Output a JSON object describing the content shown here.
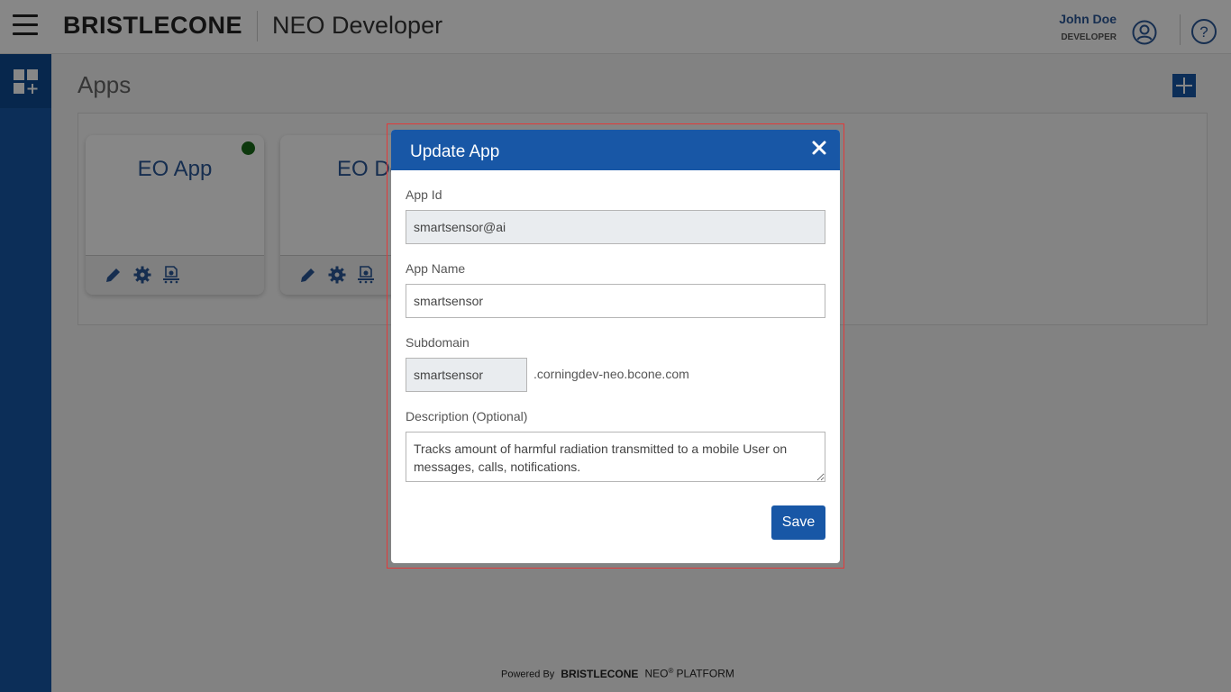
{
  "header": {
    "brand": "BRISTLECONE",
    "app_title": "NEO Developer",
    "user_name": "John Doe",
    "user_role": "DEVELOPER"
  },
  "main": {
    "title": "Apps",
    "apps": [
      {
        "name": "EO App",
        "status": "active"
      },
      {
        "name": "EO Do"
      }
    ]
  },
  "modal": {
    "title": "Update App",
    "app_id_label": "App Id",
    "app_id_value": "smartsensor@ai",
    "app_name_label": "App Name",
    "app_name_value": "smartsensor",
    "subdomain_label": "Subdomain",
    "subdomain_value": "smartsensor",
    "subdomain_suffix": ".corningdev-neo.bcone.com",
    "description_label": "Description (Optional)",
    "description_value": "Tracks amount of harmful radiation transmitted to a mobile User on messages, calls, notifications.",
    "save_label": "Save"
  },
  "footer": {
    "powered_by": "Powered By",
    "brand": "BRISTLECONE",
    "neo": "NEO",
    "reg": "®",
    "platform": "PLATFORM"
  },
  "colors": {
    "primary": "#1857a6",
    "status_active": "#1a6a1a",
    "highlight_outline": "#e23a3a"
  }
}
